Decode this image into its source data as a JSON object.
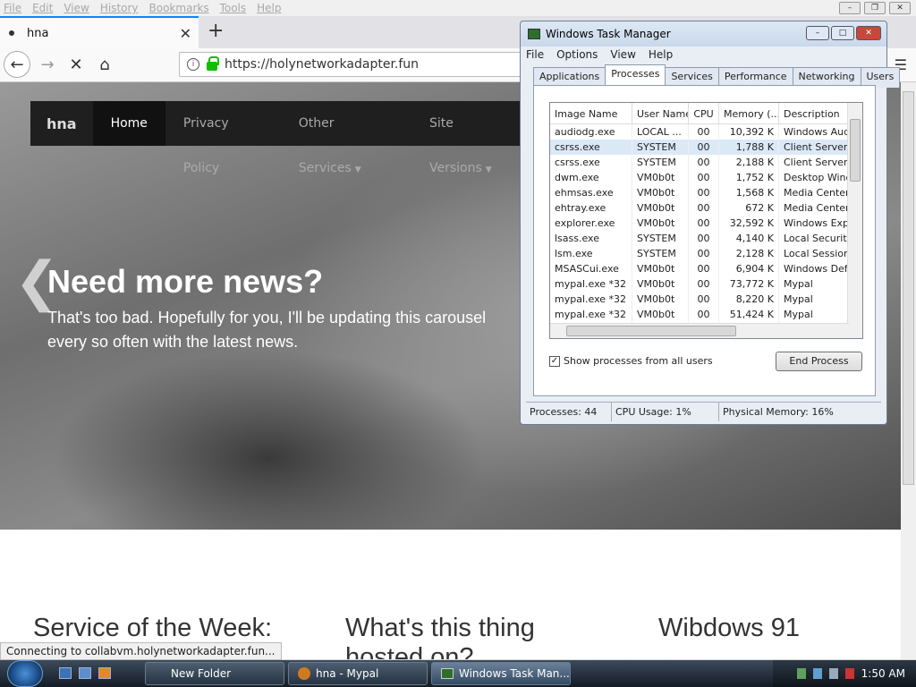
{
  "browser": {
    "menu": [
      "File",
      "Edit",
      "View",
      "History",
      "Bookmarks",
      "Tools",
      "Help"
    ],
    "tab_title": "hna",
    "url": "https://holynetworkadapter.fun",
    "status_text": "Connecting to collabvm.holynetworkadapter.fun..."
  },
  "site": {
    "brand": "hna",
    "nav": [
      "Home",
      "Privacy Policy",
      "Other Services",
      "Site Versions"
    ],
    "hero_title": "Need more news?",
    "hero_subtitle": "That's too bad. Hopefully for you, I'll be updating this carousel every so often with the latest news.",
    "sections": [
      "Service of the Week:",
      "What's this thing hosted on?",
      "Wibdows 91"
    ]
  },
  "taskmanager": {
    "title": "Windows Task Manager",
    "menu": [
      "File",
      "Options",
      "View",
      "Help"
    ],
    "tabs": [
      "Applications",
      "Processes",
      "Services",
      "Performance",
      "Networking",
      "Users"
    ],
    "active_tab": "Processes",
    "columns": [
      "Image Name",
      "User Name",
      "CPU",
      "Memory (...",
      "Description"
    ],
    "rows": [
      [
        "audiodg.exe",
        "LOCAL ...",
        "00",
        "10,392 K",
        "Windows Audio"
      ],
      [
        "csrss.exe",
        "SYSTEM",
        "00",
        "1,788 K",
        "Client Server R"
      ],
      [
        "csrss.exe",
        "SYSTEM",
        "00",
        "2,188 K",
        "Client Server R"
      ],
      [
        "dwm.exe",
        "VM0b0t",
        "00",
        "1,752 K",
        "Desktop Windo"
      ],
      [
        "ehmsas.exe",
        "VM0b0t",
        "00",
        "1,568 K",
        "Media Center I"
      ],
      [
        "ehtray.exe",
        "VM0b0t",
        "00",
        "672 K",
        "Media Center T"
      ],
      [
        "explorer.exe",
        "VM0b0t",
        "00",
        "32,592 K",
        "Windows Explo"
      ],
      [
        "lsass.exe",
        "SYSTEM",
        "00",
        "4,140 K",
        "Local Security"
      ],
      [
        "lsm.exe",
        "SYSTEM",
        "00",
        "2,128 K",
        "Local Session M"
      ],
      [
        "MSASCui.exe",
        "VM0b0t",
        "00",
        "6,904 K",
        "Windows Defe"
      ],
      [
        "mypal.exe *32",
        "VM0b0t",
        "00",
        "73,772 K",
        "Mypal"
      ],
      [
        "mypal.exe *32",
        "VM0b0t",
        "00",
        "8,220 K",
        "Mypal"
      ],
      [
        "mypal.exe *32",
        "VM0b0t",
        "00",
        "51,424 K",
        "Mypal"
      ],
      [
        "mypal.exe *32",
        "VM0b0t",
        "00",
        "13,120 K",
        "Mypal"
      ]
    ],
    "show_all_label": "Show processes from all users",
    "end_process_label": "End Process",
    "status": {
      "processes": "Processes: 44",
      "cpu": "CPU Usage: 1%",
      "memory": "Physical Memory: 16%"
    }
  },
  "taskbar": {
    "buttons": [
      "New Folder",
      "hna - Mypal",
      "Windows Task Man..."
    ],
    "clock": "1:50 AM"
  }
}
